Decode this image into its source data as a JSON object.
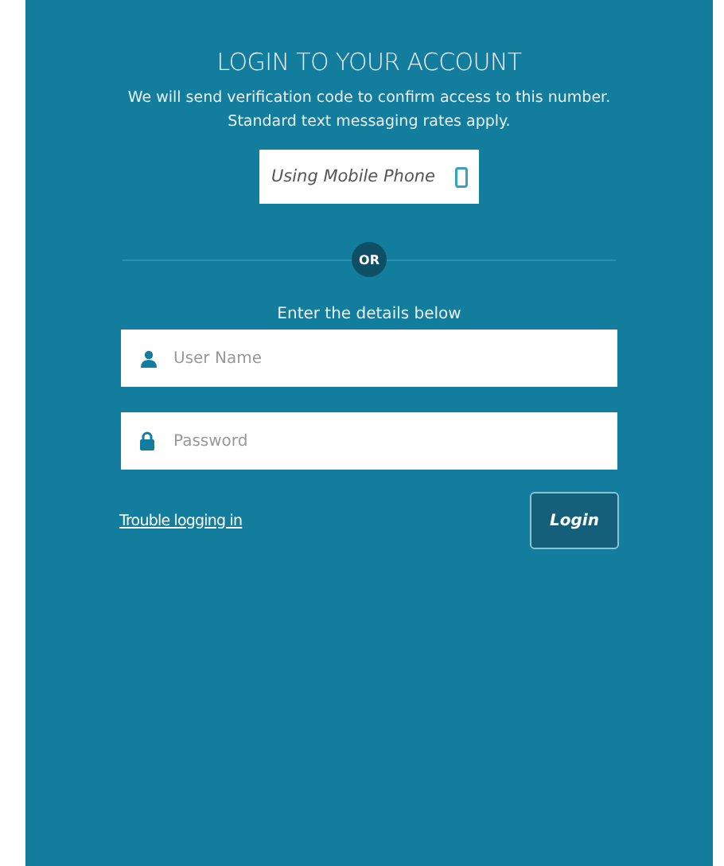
{
  "title": "LOGIN TO YOUR ACCOUNT",
  "subtitle_lines": [
    "We will send verification code to confirm access to this number.",
    "Standard text messaging rates apply."
  ],
  "mobile_button": {
    "label": "Using Mobile Phone"
  },
  "divider_label": "OR",
  "details_prompt": "Enter the details below",
  "fields": [
    {
      "kind": "user",
      "placeholder": "User Name"
    },
    {
      "kind": "password",
      "placeholder": "Password"
    }
  ],
  "trouble_link": "Trouble logging in",
  "login_button": "Login"
}
